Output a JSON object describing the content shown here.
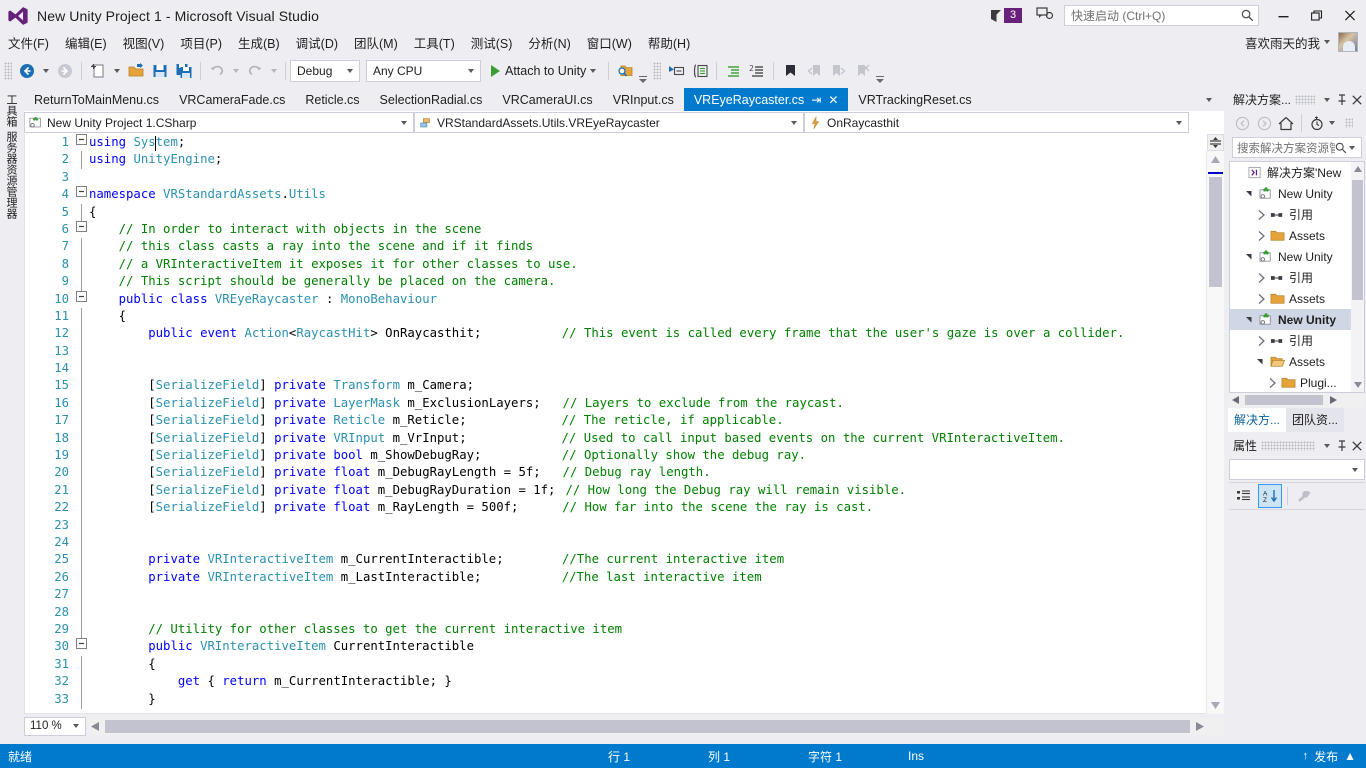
{
  "titlebar": {
    "title": "New Unity Project 1 - Microsoft Visual Studio",
    "notification_count": "3",
    "quick_launch_placeholder": "快速启动 (Ctrl+Q)",
    "minimize": "—",
    "restore": "❐",
    "close": "✕"
  },
  "menubar": {
    "items": [
      {
        "label": "文件(F)"
      },
      {
        "label": "编辑(E)"
      },
      {
        "label": "视图(V)"
      },
      {
        "label": "项目(P)"
      },
      {
        "label": "生成(B)"
      },
      {
        "label": "调试(D)"
      },
      {
        "label": "团队(M)"
      },
      {
        "label": "工具(T)"
      },
      {
        "label": "测试(S)"
      },
      {
        "label": "分析(N)"
      },
      {
        "label": "窗口(W)"
      },
      {
        "label": "帮助(H)"
      }
    ],
    "user_name": "喜欢雨天的我"
  },
  "toolbar": {
    "config": "Debug",
    "platform": "Any CPU",
    "run_label": "Attach to Unity"
  },
  "vertical_tabs": [
    {
      "label": "工具箱"
    },
    {
      "label": "服务器资源管理器"
    }
  ],
  "doc_tabs": [
    {
      "label": "ReturnToMainMenu.cs",
      "active": false
    },
    {
      "label": "VRCameraFade.cs",
      "active": false
    },
    {
      "label": "Reticle.cs",
      "active": false
    },
    {
      "label": "SelectionRadial.cs",
      "active": false
    },
    {
      "label": "VRCameraUI.cs",
      "active": false
    },
    {
      "label": "VRInput.cs",
      "active": false
    },
    {
      "label": "VREyeRaycaster.cs",
      "active": true
    },
    {
      "label": "VRTrackingReset.cs",
      "active": false
    }
  ],
  "navbar": {
    "project": "New Unity Project 1.CSharp",
    "type": "VRStandardAssets.Utils.VREyeRaycaster",
    "member": "OnRaycasthit"
  },
  "editor": {
    "zoom": "110 %",
    "lines": [
      {
        "n": "1",
        "fold": "minus",
        "code": "using System;"
      },
      {
        "n": "2",
        "fold": "bar",
        "code": "using UnityEngine;"
      },
      {
        "n": "3",
        "fold": "",
        "code": ""
      },
      {
        "n": "4",
        "fold": "minus",
        "code": "namespace VRStandardAssets.Utils"
      },
      {
        "n": "5",
        "fold": "bar",
        "code": "{"
      },
      {
        "n": "6",
        "fold": "minus2",
        "code": "    // In order to interact with objects in the scene"
      },
      {
        "n": "7",
        "fold": "bar2",
        "code": "    // this class casts a ray into the scene and if it finds"
      },
      {
        "n": "8",
        "fold": "bar2",
        "code": "    // a VRInteractiveItem it exposes it for other classes to use."
      },
      {
        "n": "9",
        "fold": "bar2",
        "code": "    // This script should be generally be placed on the camera."
      },
      {
        "n": "10",
        "fold": "minus2",
        "code": "    public class VREyeRaycaster : MonoBehaviour"
      },
      {
        "n": "11",
        "fold": "bar2",
        "code": "    {"
      },
      {
        "n": "12",
        "fold": "bar2",
        "code": "        public event Action<RaycastHit> OnRaycasthit;",
        "comment": "// This event is called every frame that the user's gaze is over a collider."
      },
      {
        "n": "13",
        "fold": "bar2",
        "code": ""
      },
      {
        "n": "14",
        "fold": "bar2",
        "code": ""
      },
      {
        "n": "15",
        "fold": "bar2",
        "code": "        [SerializeField] private Transform m_Camera;"
      },
      {
        "n": "16",
        "fold": "bar2",
        "code": "        [SerializeField] private LayerMask m_ExclusionLayers;",
        "comment": "// Layers to exclude from the raycast."
      },
      {
        "n": "17",
        "fold": "bar2",
        "code": "        [SerializeField] private Reticle m_Reticle;",
        "comment": "// The reticle, if applicable."
      },
      {
        "n": "18",
        "fold": "bar2",
        "code": "        [SerializeField] private VRInput m_VrInput;",
        "comment": "// Used to call input based events on the current VRInteractiveItem."
      },
      {
        "n": "19",
        "fold": "bar2",
        "code": "        [SerializeField] private bool m_ShowDebugRay;",
        "comment": "// Optionally show the debug ray."
      },
      {
        "n": "20",
        "fold": "bar2",
        "code": "        [SerializeField] private float m_DebugRayLength = 5f;",
        "comment": "// Debug ray length."
      },
      {
        "n": "21",
        "fold": "bar2",
        "code": "        [SerializeField] private float m_DebugRayDuration = 1f;",
        "comment": "// How long the Debug ray will remain visible."
      },
      {
        "n": "22",
        "fold": "bar2",
        "code": "        [SerializeField] private float m_RayLength = 500f;",
        "comment": "// How far into the scene the ray is cast."
      },
      {
        "n": "23",
        "fold": "bar2",
        "code": ""
      },
      {
        "n": "24",
        "fold": "bar2",
        "code": ""
      },
      {
        "n": "25",
        "fold": "bar2",
        "code": "        private VRInteractiveItem m_CurrentInteractible;",
        "comment": "//The current interactive item"
      },
      {
        "n": "26",
        "fold": "bar2",
        "code": "        private VRInteractiveItem m_LastInteractible;",
        "comment": "//The last interactive item"
      },
      {
        "n": "27",
        "fold": "bar2",
        "code": ""
      },
      {
        "n": "28",
        "fold": "bar2",
        "code": ""
      },
      {
        "n": "29",
        "fold": "bar2",
        "code": "        // Utility for other classes to get the current interactive item"
      },
      {
        "n": "30",
        "fold": "minus2",
        "code": "        public VRInteractiveItem CurrentInteractible"
      },
      {
        "n": "31",
        "fold": "bar2",
        "code": "        {"
      },
      {
        "n": "32",
        "fold": "bar2",
        "code": "            get { return m_CurrentInteractible; }"
      },
      {
        "n": "33",
        "fold": "bar2",
        "code": "        }"
      }
    ]
  },
  "solution_explorer": {
    "panel_title": "解决方案...",
    "search_placeholder": "搜索解决方案资源管理器",
    "tree": [
      {
        "label": "解决方案'New",
        "indent": 0,
        "twisty": "none",
        "icon": "solution-icon",
        "selected": false
      },
      {
        "label": "New Unity",
        "indent": 1,
        "twisty": "down",
        "icon": "csproj-icon",
        "selected": false
      },
      {
        "label": "引用",
        "indent": 2,
        "twisty": "right",
        "icon": "references-icon",
        "selected": false
      },
      {
        "label": "Assets",
        "indent": 2,
        "twisty": "right",
        "icon": "folder-icon",
        "selected": false
      },
      {
        "label": "New Unity",
        "indent": 1,
        "twisty": "down",
        "icon": "csproj-icon",
        "selected": false
      },
      {
        "label": "引用",
        "indent": 2,
        "twisty": "right",
        "icon": "references-icon",
        "selected": false
      },
      {
        "label": "Assets",
        "indent": 2,
        "twisty": "right",
        "icon": "folder-icon",
        "selected": false
      },
      {
        "label": "New Unity",
        "indent": 1,
        "twisty": "down",
        "icon": "csproj-icon",
        "selected": true
      },
      {
        "label": "引用",
        "indent": 2,
        "twisty": "right",
        "icon": "references-icon",
        "selected": false
      },
      {
        "label": "Assets",
        "indent": 2,
        "twisty": "down",
        "icon": "folder-open-icon",
        "selected": false
      },
      {
        "label": "Plugi...",
        "indent": 3,
        "twisty": "right",
        "icon": "folder-icon",
        "selected": false
      }
    ]
  },
  "dock_tabs": [
    {
      "label": "解决方...",
      "active": true
    },
    {
      "label": "团队资...",
      "active": false
    }
  ],
  "properties": {
    "panel_title": "属性",
    "value": ""
  },
  "statusbar": {
    "ready": "就绪",
    "line_label": "行 1",
    "col_label": "列 1",
    "char_label": "字符 1",
    "insert_mode": "Ins",
    "publish": "发布"
  },
  "colors": {
    "accent_blue": "#007acc",
    "chrome": "#eeeef2",
    "badge_purple": "#68217a",
    "keyword": "#0000ff",
    "type": "#2b91af",
    "comment": "#008000",
    "linenum": "#2b91af"
  }
}
